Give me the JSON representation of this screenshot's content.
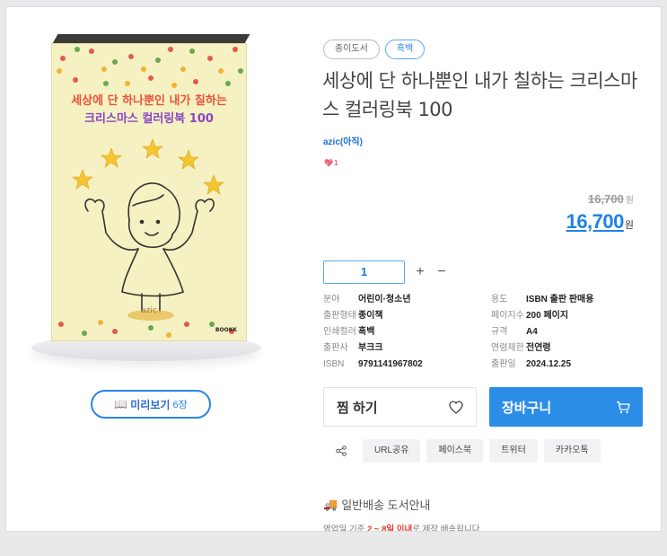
{
  "book": {
    "cover_title_line1": "세상에 단 하나뿐인 내가 칠하는",
    "cover_title_line2": "크리스마스 컬러링북 100",
    "cover_author": "azic",
    "cover_publisher": "BOOKK"
  },
  "preview": {
    "icon": "book-icon",
    "label": "미리보기",
    "count": "6장"
  },
  "tags": [
    "종이도서",
    "흑백"
  ],
  "title": "세상에 단 하나뿐인 내가 칠하는 크리스마스 컬러링북 100",
  "author": "azic(아직)",
  "likes": {
    "icon": "heart-icon",
    "count": "1"
  },
  "price": {
    "original": "16,700",
    "original_unit": "원",
    "sale": "16,700",
    "sale_unit": "원"
  },
  "quantity": {
    "value": "1",
    "plus": "+",
    "minus": "−"
  },
  "specs": [
    {
      "key": "분야",
      "value": "어린이·청소년"
    },
    {
      "key": "용도",
      "value": "ISBN 출판 판매용"
    },
    {
      "key": "출판형태",
      "value": "종이책"
    },
    {
      "key": "페이지수",
      "value": "200 페이지"
    },
    {
      "key": "인쇄컬러",
      "value": "흑백"
    },
    {
      "key": "규격",
      "value": "A4"
    },
    {
      "key": "출판사",
      "value": "부크크"
    },
    {
      "key": "연령제한",
      "value": "전연령"
    },
    {
      "key": "ISBN",
      "value": "9791141967802"
    },
    {
      "key": "출판일",
      "value": "2024.12.25"
    }
  ],
  "actions": {
    "wish_label": "찜 하기",
    "cart_label": "장바구니"
  },
  "share": {
    "icon": "share-icon",
    "buttons": [
      "URL공유",
      "페이스북",
      "트위터",
      "카카오톡"
    ]
  },
  "shipping": {
    "icon": "truck-icon",
    "title": "일반배송 도서안내",
    "note_prefix": "영업일 기준 ",
    "note_highlight": "2 ~ 8일 이내",
    "note_suffix": "로 제작 배송됩니다."
  },
  "colors": {
    "accent": "#2b8de6",
    "price_blue": "#1c83e6",
    "cover_bg": "#f6f1c2",
    "highlight_red": "#e33b2e"
  }
}
